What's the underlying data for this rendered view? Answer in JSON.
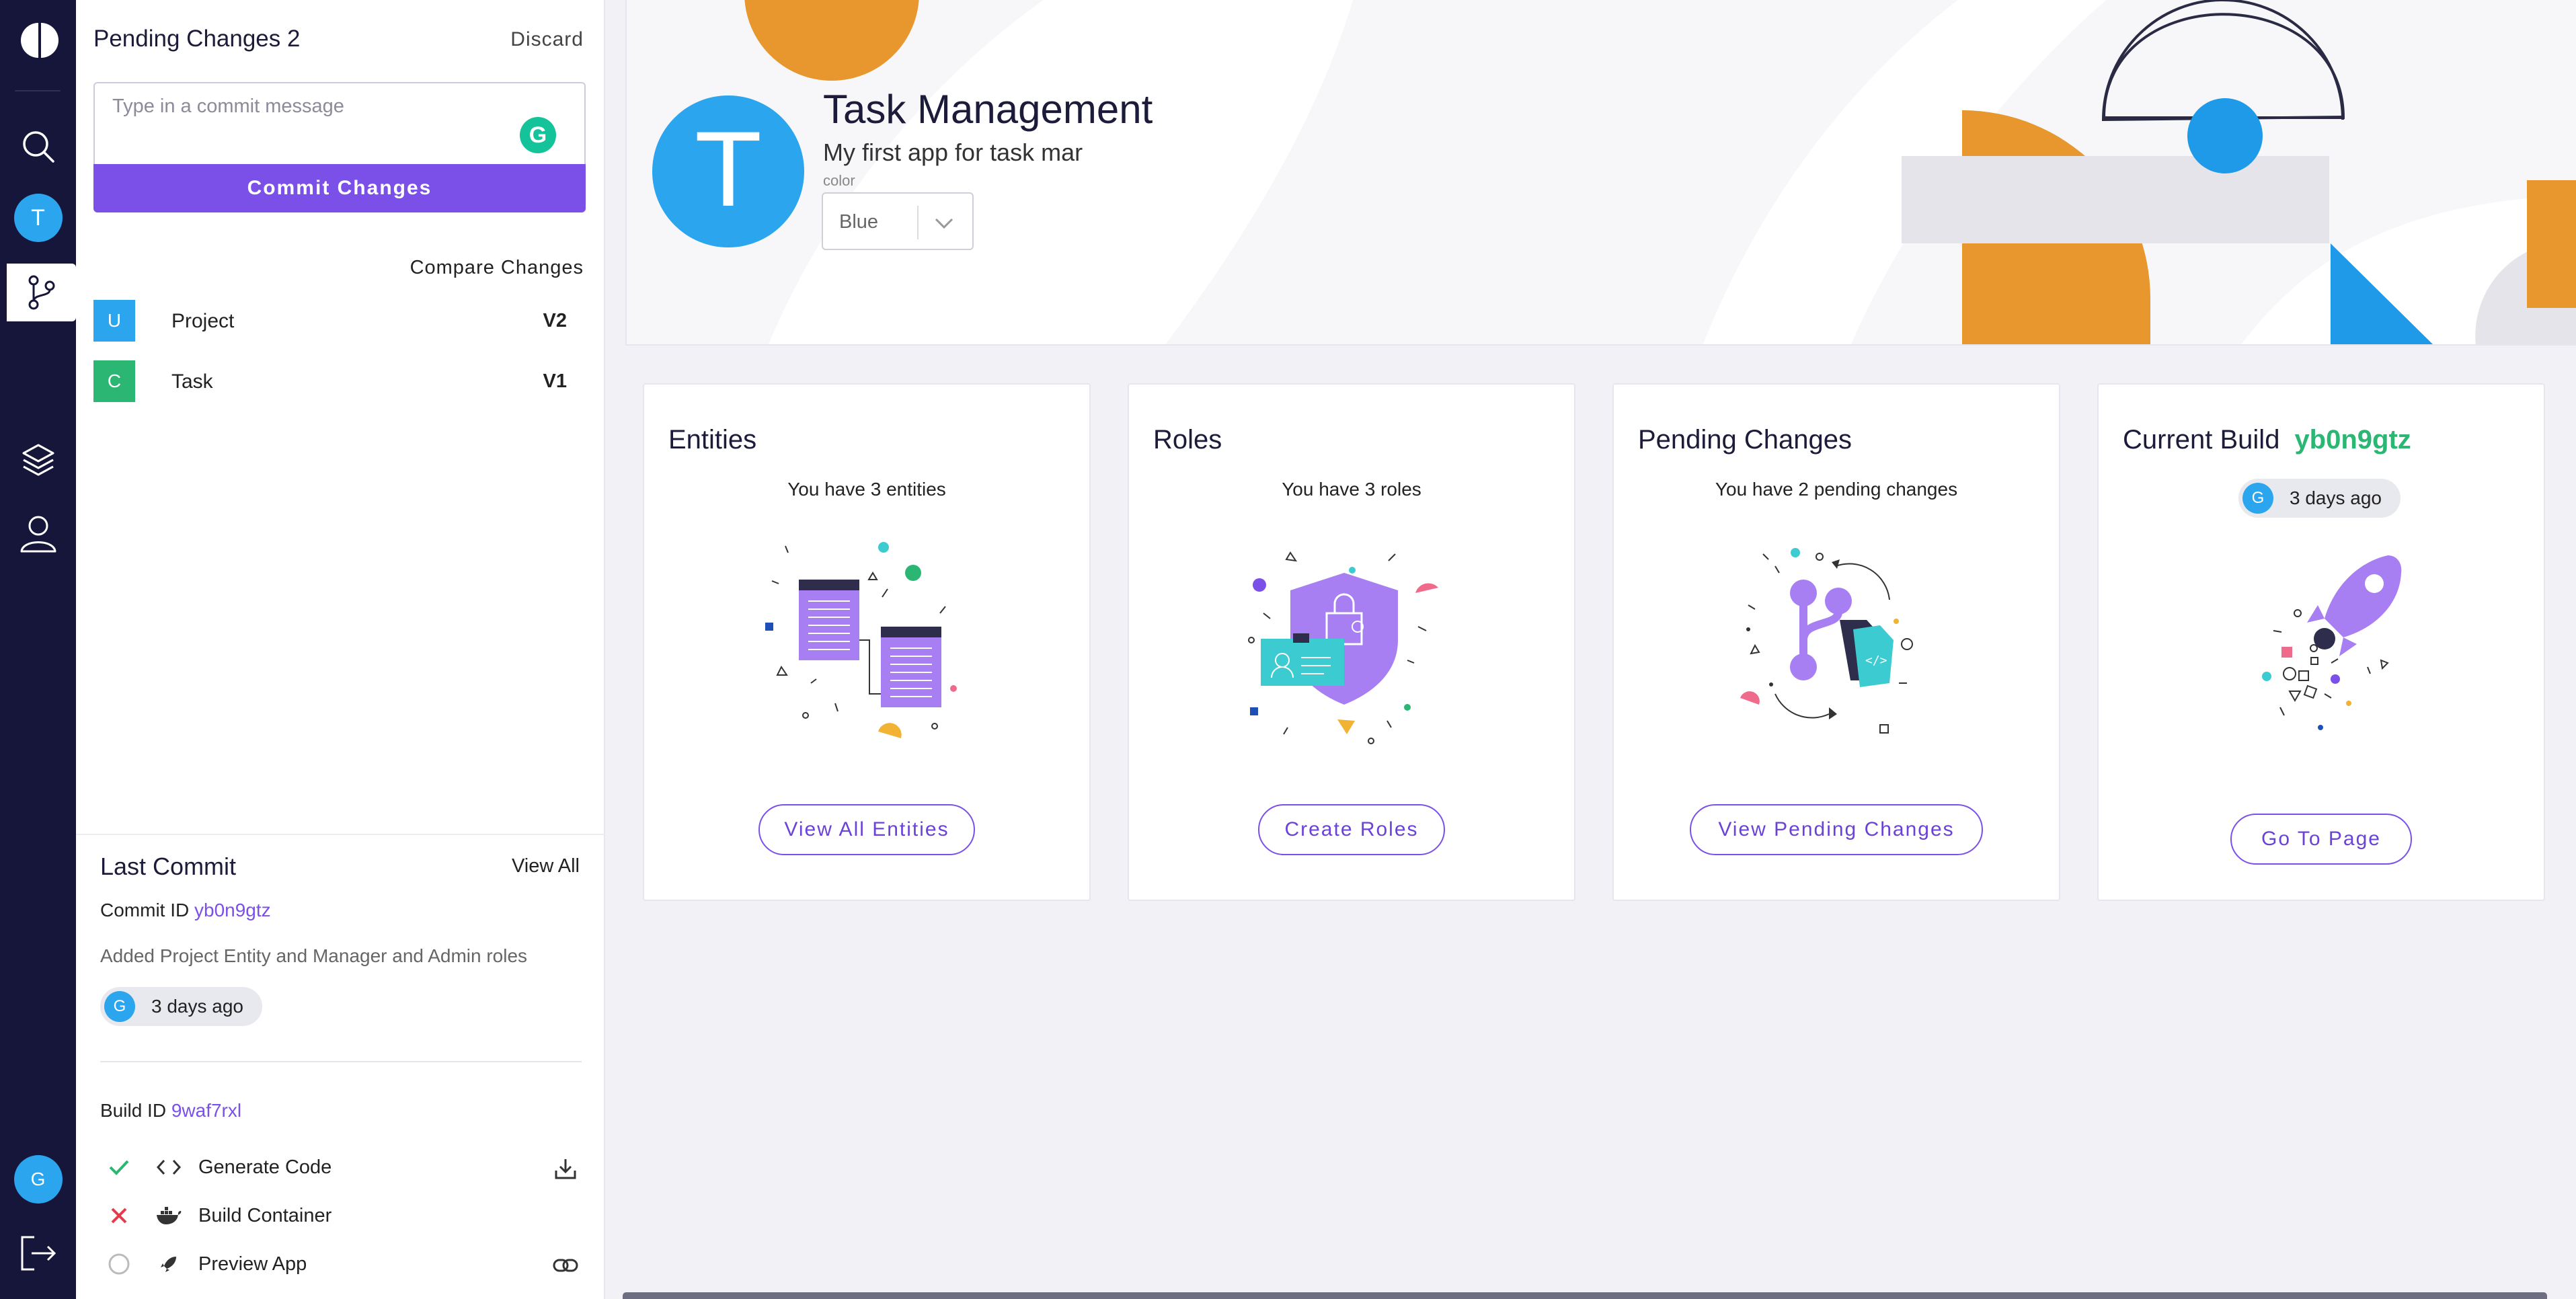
{
  "rail": {
    "avatar_top": "T",
    "avatar_bottom": "G"
  },
  "pending": {
    "title": "Pending Changes 2",
    "discard": "Discard",
    "commit_placeholder": "Type in a commit message",
    "grammarly": "G",
    "commit_button": "Commit Changes",
    "compare": "Compare Changes",
    "changes": [
      {
        "badge": "U",
        "badge_color": "#2ba5ee",
        "name": "Project",
        "version": "V2"
      },
      {
        "badge": "C",
        "badge_color": "#2bb673",
        "name": "Task",
        "version": "V1"
      }
    ]
  },
  "last_commit": {
    "title": "Last Commit",
    "view_all": "View All",
    "commit_id_label": "Commit ID",
    "commit_id": "yb0n9gtz",
    "message": "Added Project Entity and Manager and Admin roles",
    "user_initial": "G",
    "time": "3 days ago",
    "build_id_label": "Build ID",
    "build_id": "9waf7rxl",
    "steps": [
      {
        "label": "Generate Code",
        "status": "success"
      },
      {
        "label": "Build Container",
        "status": "failed"
      },
      {
        "label": "Preview App",
        "status": "pending"
      }
    ]
  },
  "app": {
    "initial": "T",
    "name": "Task Management",
    "description": "My first app for task mar",
    "color_label": "color",
    "color_value": "Blue"
  },
  "cards": {
    "entities": {
      "title": "Entities",
      "subtitle": "You have 3 entities",
      "button": "View All Entities"
    },
    "roles": {
      "title": "Roles",
      "subtitle": "You have 3 roles",
      "button": "Create Roles"
    },
    "pending": {
      "title": "Pending Changes",
      "subtitle": "You have 2 pending changes",
      "button": "View Pending Changes"
    },
    "build": {
      "title": "Current Build",
      "build_id": "yb0n9gtz",
      "user_initial": "G",
      "time": "3 days ago",
      "button": "Go To Page"
    }
  },
  "colors": {
    "accent": "#7b50e8",
    "rail": "#15163a",
    "blue": "#2ba5ee",
    "green": "#2bb673",
    "orange": "#e8962e"
  }
}
